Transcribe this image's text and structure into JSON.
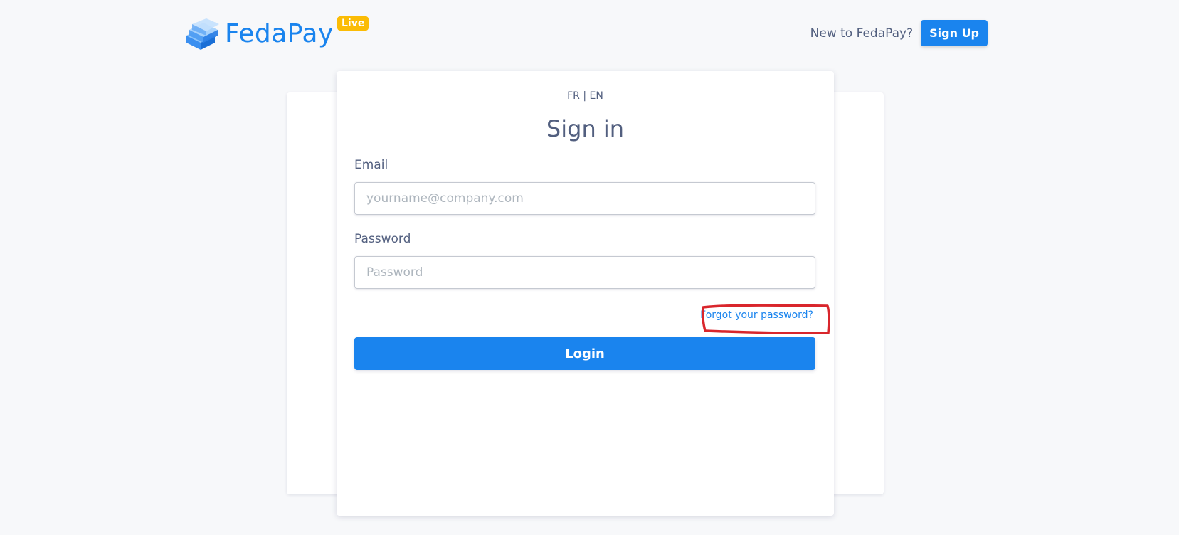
{
  "header": {
    "brand": "FedaPay",
    "badge": "Live",
    "new_to_text": "New to FedaPay?",
    "signup_label": "Sign Up"
  },
  "lang": {
    "fr": "FR",
    "separator": "|",
    "en": "EN"
  },
  "form": {
    "title": "Sign in",
    "email_label": "Email",
    "email_placeholder": "yourname@company.com",
    "email_value": "",
    "password_label": "Password",
    "password_placeholder": "Password",
    "password_value": "",
    "forgot_label": "Forgot your password?",
    "login_label": "Login"
  },
  "colors": {
    "accent": "#1a84ee",
    "badge": "#fbbc05",
    "annotation": "#d9262c",
    "background": "#f7f8fa"
  },
  "icons": {
    "logo": "stacked-layers-icon"
  }
}
